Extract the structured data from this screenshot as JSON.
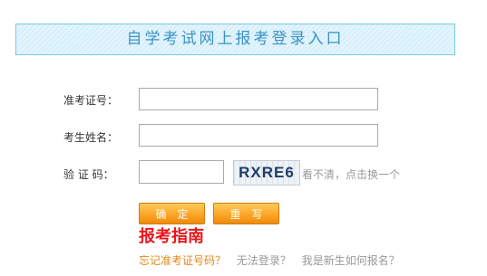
{
  "header": {
    "title": "自学考试网上报考登录入口"
  },
  "form": {
    "exam_id_label": "准考证号：",
    "exam_id_value": "",
    "name_label": "考生姓名：",
    "name_value": "",
    "captcha_label": "验 证 码：",
    "captcha_value": "",
    "captcha_image_text": "RXRE6",
    "captcha_refresh_text": "看不清，点击换一个"
  },
  "buttons": {
    "confirm_label": "确定",
    "reset_label": "重写"
  },
  "guide": {
    "heading": "报考指南",
    "links": [
      "忘记准考证号码？",
      "无法登录？",
      "我是新生如何报名？"
    ]
  },
  "colors": {
    "banner_text": "#3a93c6",
    "button_orange": "#fba628",
    "guide_red": "#e8161c",
    "link_orange": "#e08a1e"
  }
}
